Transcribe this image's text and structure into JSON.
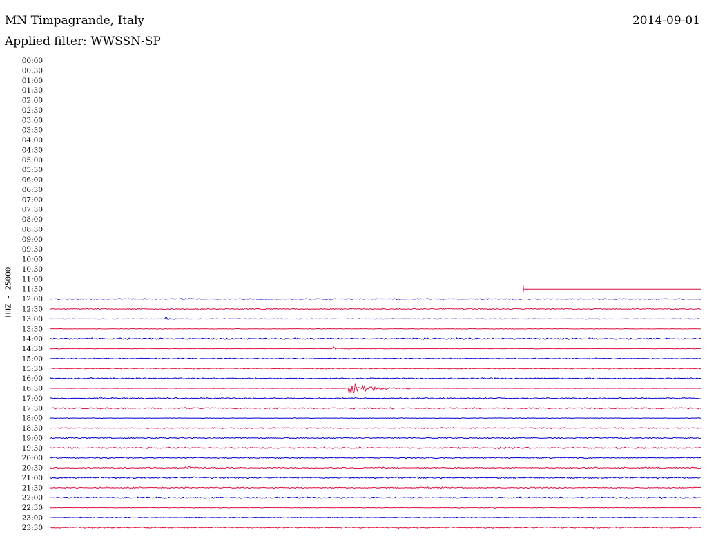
{
  "header": {
    "station": "MN Timpagrande, Italy",
    "filter": "Applied filter: WWSSN-SP",
    "date": "2014-09-01",
    "channel_label": "HHZ - 25000"
  },
  "chart_data": {
    "type": "line",
    "title": "MN Timpagrande, Italy",
    "subtitle": "Applied filter: WWSSN-SP",
    "date": "2014-09-01",
    "ylabel": "HHZ - 25000",
    "row_labels": [
      "00:00",
      "00:30",
      "01:00",
      "01:30",
      "02:00",
      "02:30",
      "03:00",
      "03:30",
      "04:00",
      "04:30",
      "05:00",
      "05:30",
      "06:00",
      "06:30",
      "07:00",
      "07:30",
      "08:00",
      "08:30",
      "09:00",
      "09:30",
      "10:00",
      "10:30",
      "11:00",
      "11:30",
      "12:00",
      "12:30",
      "13:00",
      "13:30",
      "14:00",
      "14:30",
      "15:00",
      "15:30",
      "16:00",
      "16:30",
      "17:00",
      "17:30",
      "18:00",
      "18:30",
      "19:00",
      "19:30",
      "20:00",
      "20:30",
      "21:00",
      "21:30",
      "22:00",
      "22:30",
      "23:00",
      "23:30"
    ],
    "row_minutes": 30,
    "data_start_minute_in_row": 21.8,
    "data_start_row": "11:30",
    "colors": {
      "odd_rows": "#0000cc",
      "even_rows": "#dd1144",
      "empty_row": "#000000"
    },
    "noise_level": {
      "12:00": 1.0,
      "12:30": 1.4,
      "13:00": 0.6,
      "13:30": 0.7,
      "14:00": 1.6,
      "14:30": 0.6,
      "15:00": 1.1,
      "15:30": 1.0,
      "16:00": 1.4,
      "16:30": 0.5,
      "17:00": 1.4,
      "17:30": 1.5,
      "18:00": 0.6,
      "18:30": 1.2,
      "19:00": 1.5,
      "19:30": 1.6,
      "20:00": 1.3,
      "20:30": 1.5,
      "21:00": 1.7,
      "21:30": 1.4,
      "22:00": 1.5,
      "22:30": 0.7,
      "23:00": 0.9,
      "23:30": 1.5
    },
    "events": [
      {
        "row": "13:00",
        "minute": 5.3,
        "duration_min": 0.6,
        "amplitude": 3
      },
      {
        "row": "14:30",
        "minute": 13.0,
        "duration_min": 0.8,
        "amplitude": 3
      },
      {
        "row": "16:30",
        "minute": 13.6,
        "duration_min": 3.1,
        "amplitude": 16
      },
      {
        "row": "20:30",
        "minute": 2.8,
        "duration_min": 0.5,
        "amplitude": 2
      },
      {
        "row": "20:30",
        "minute": 6.2,
        "duration_min": 1.0,
        "amplitude": 3
      },
      {
        "row": "22:30",
        "minute": 20.3,
        "duration_min": 0.3,
        "amplitude": 2.5
      }
    ]
  }
}
